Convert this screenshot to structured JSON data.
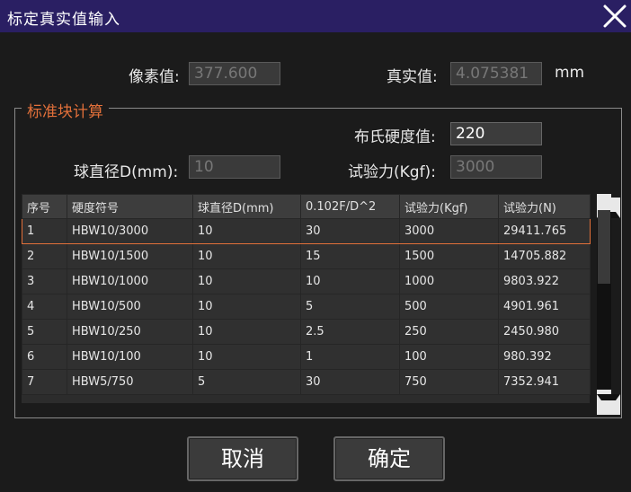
{
  "window": {
    "title": "标定真实值输入"
  },
  "pixel_value": {
    "label": "像素值:",
    "value": "377.600"
  },
  "real_value": {
    "label": "真实值:",
    "value": "4.075381",
    "unit": "mm"
  },
  "group": {
    "title": "标准块计算"
  },
  "brinell": {
    "label": "布氏硬度值:",
    "value": "220"
  },
  "ball_diameter": {
    "label": "球直径D(mm):",
    "value": "10"
  },
  "test_force": {
    "label": "试验力(Kgf):",
    "value": "3000"
  },
  "table": {
    "headers": [
      "序号",
      "硬度符号",
      "球直径D(mm)",
      "0.102F/D^2",
      "试验力(Kgf)",
      "试验力(N)"
    ],
    "rows": [
      [
        "1",
        "HBW10/3000",
        "10",
        "30",
        "3000",
        "29411.765"
      ],
      [
        "2",
        "HBW10/1500",
        "10",
        "15",
        "1500",
        "14705.882"
      ],
      [
        "3",
        "HBW10/1000",
        "10",
        "10",
        "1000",
        "9803.922"
      ],
      [
        "4",
        "HBW10/500",
        "10",
        "5",
        "500",
        "4901.961"
      ],
      [
        "5",
        "HBW10/250",
        "10",
        "2.5",
        "250",
        "2450.980"
      ],
      [
        "6",
        "HBW10/100",
        "10",
        "1",
        "100",
        "980.392"
      ],
      [
        "7",
        "HBW5/750",
        "5",
        "30",
        "750",
        "7352.941"
      ]
    ],
    "selected_row": 0
  },
  "buttons": {
    "cancel": "取消",
    "ok": "确定"
  },
  "colors": {
    "titlebar": "#2a1f63",
    "accent": "#e2703a"
  },
  "icons": {
    "close": "close-icon",
    "scroll_up": "scroll-up-icon",
    "scroll_down": "scroll-down-icon"
  }
}
